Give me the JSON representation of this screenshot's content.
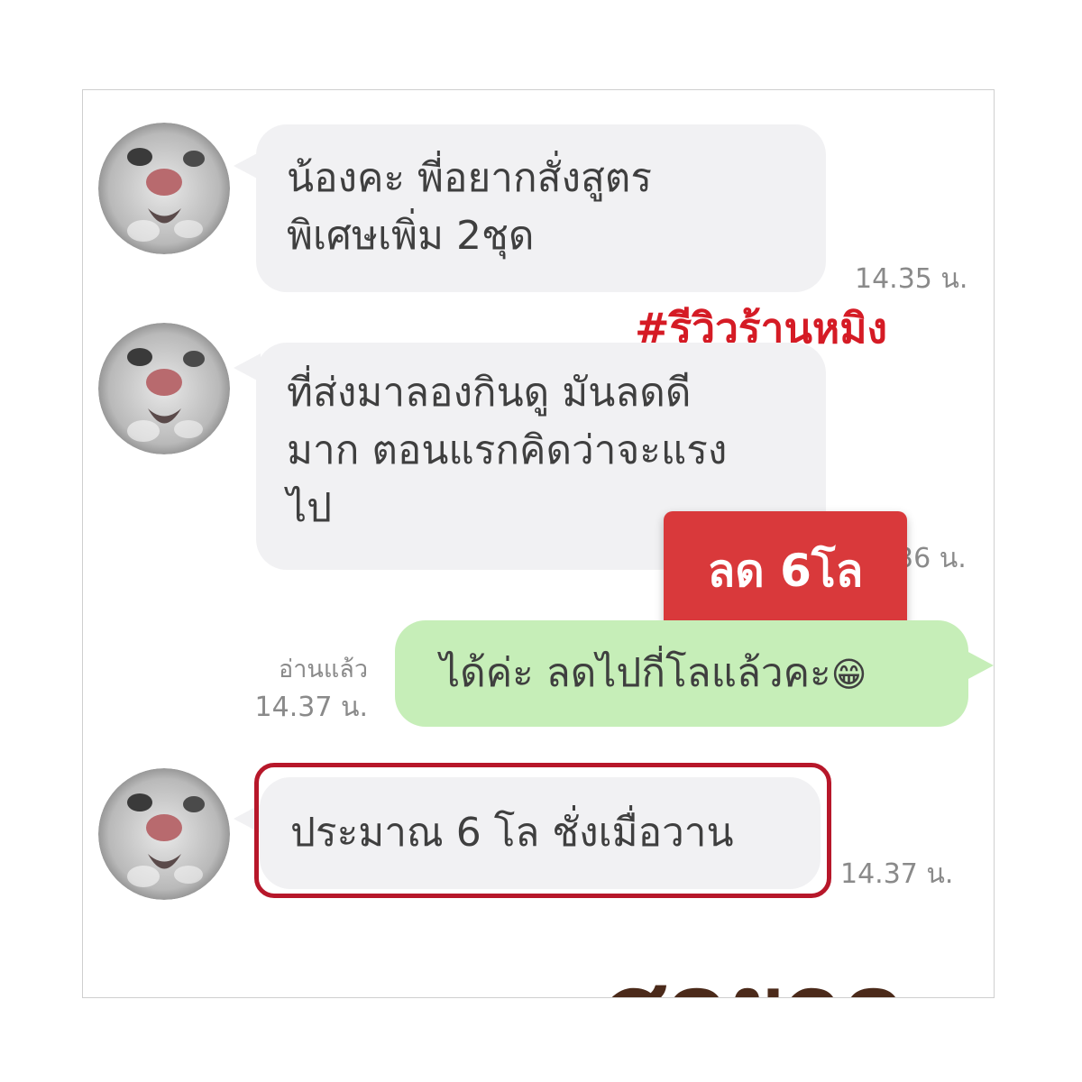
{
  "messages": [
    {
      "direction": "incoming",
      "lines": [
        "น้องคะ พี่อยากสั่งสูตร",
        "พิเศษเพิ่ม 2ชุด"
      ],
      "time": "14.35 น."
    },
    {
      "direction": "incoming",
      "lines": [
        "ที่ส่งมาลองกินดู มันลดดี",
        "มาก ตอนแรกคิดว่าจะแรง",
        "ไป"
      ],
      "time": "36 น."
    },
    {
      "direction": "outgoing",
      "text": "ได้ค่ะ ลดไปกี่โลแล้วคะ",
      "emoji": "😁",
      "read_label": "อ่านแล้ว",
      "time": "14.37 น."
    },
    {
      "direction": "incoming",
      "lines": [
        "ประมาณ 6 โล ชั่งเมื่อวาน"
      ],
      "time": "14.37 น.",
      "highlighted": true
    }
  ],
  "overlays": {
    "hashtag": "#รีวิวร้านหมิง",
    "badge": "ลด 6โล",
    "sticker_text": "สุดยอด"
  },
  "colors": {
    "incoming_bubble": "#f1f1f3",
    "outgoing_bubble": "#c6eeb8",
    "hashtag": "#d51b25",
    "badge_bg": "#d9393b",
    "highlight_border": "#b7172a"
  },
  "avatar": {
    "icon": "cat-face-avatar"
  }
}
